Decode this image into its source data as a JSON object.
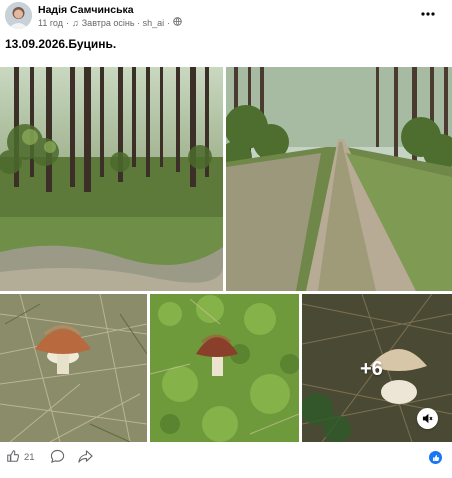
{
  "post": {
    "author": "Надія Самчинська",
    "time": "11 год",
    "song_icon": "music-note-icon",
    "song": "Завтра осінь · sh_ai",
    "audience_icon": "globe-icon",
    "more_icon": "more-horizontal-icon",
    "caption": "13.09.2026.Буцинь."
  },
  "gallery": {
    "extra_count": "+6",
    "mute_icon": "speaker-muted-icon"
  },
  "footer": {
    "like_icon": "thumbs-up-icon",
    "like_count": "21",
    "comment_icon": "comment-icon",
    "share_icon": "share-icon",
    "reaction_badge_icon": "like-reaction-badge-icon"
  },
  "colors": {
    "reaction_blue": "#1877f2",
    "meta_gray": "#65676b"
  }
}
